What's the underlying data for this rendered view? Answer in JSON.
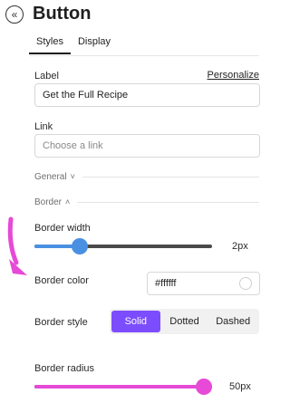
{
  "header": {
    "back_icon": "chevron-double-left-icon",
    "title": "Button"
  },
  "tabs": [
    {
      "label": "Styles",
      "active": true
    },
    {
      "label": "Display",
      "active": false
    }
  ],
  "fields": {
    "label": {
      "label": "Label",
      "link": "Personalize",
      "value": "Get the Full Recipe"
    },
    "link": {
      "label": "Link",
      "placeholder": "Choose a link"
    }
  },
  "sections": {
    "general": {
      "label": "General",
      "chevron": "˅"
    },
    "border": {
      "label": "Border",
      "chevron": "˄"
    }
  },
  "border": {
    "width": {
      "label": "Border width",
      "value": "2px",
      "fraction": 0.23
    },
    "color": {
      "label": "Border color",
      "value": "#ffffff"
    },
    "style": {
      "label": "Border style",
      "options": [
        "Solid",
        "Dotted",
        "Dashed"
      ],
      "selected": "Solid"
    },
    "radius": {
      "label": "Border radius",
      "value": "50px",
      "fraction": 1.0
    }
  },
  "colors": {
    "accent_purple": "#7c4dff",
    "slider_blue": "#4a90e2",
    "highlight_pink": "#e64ad6"
  }
}
